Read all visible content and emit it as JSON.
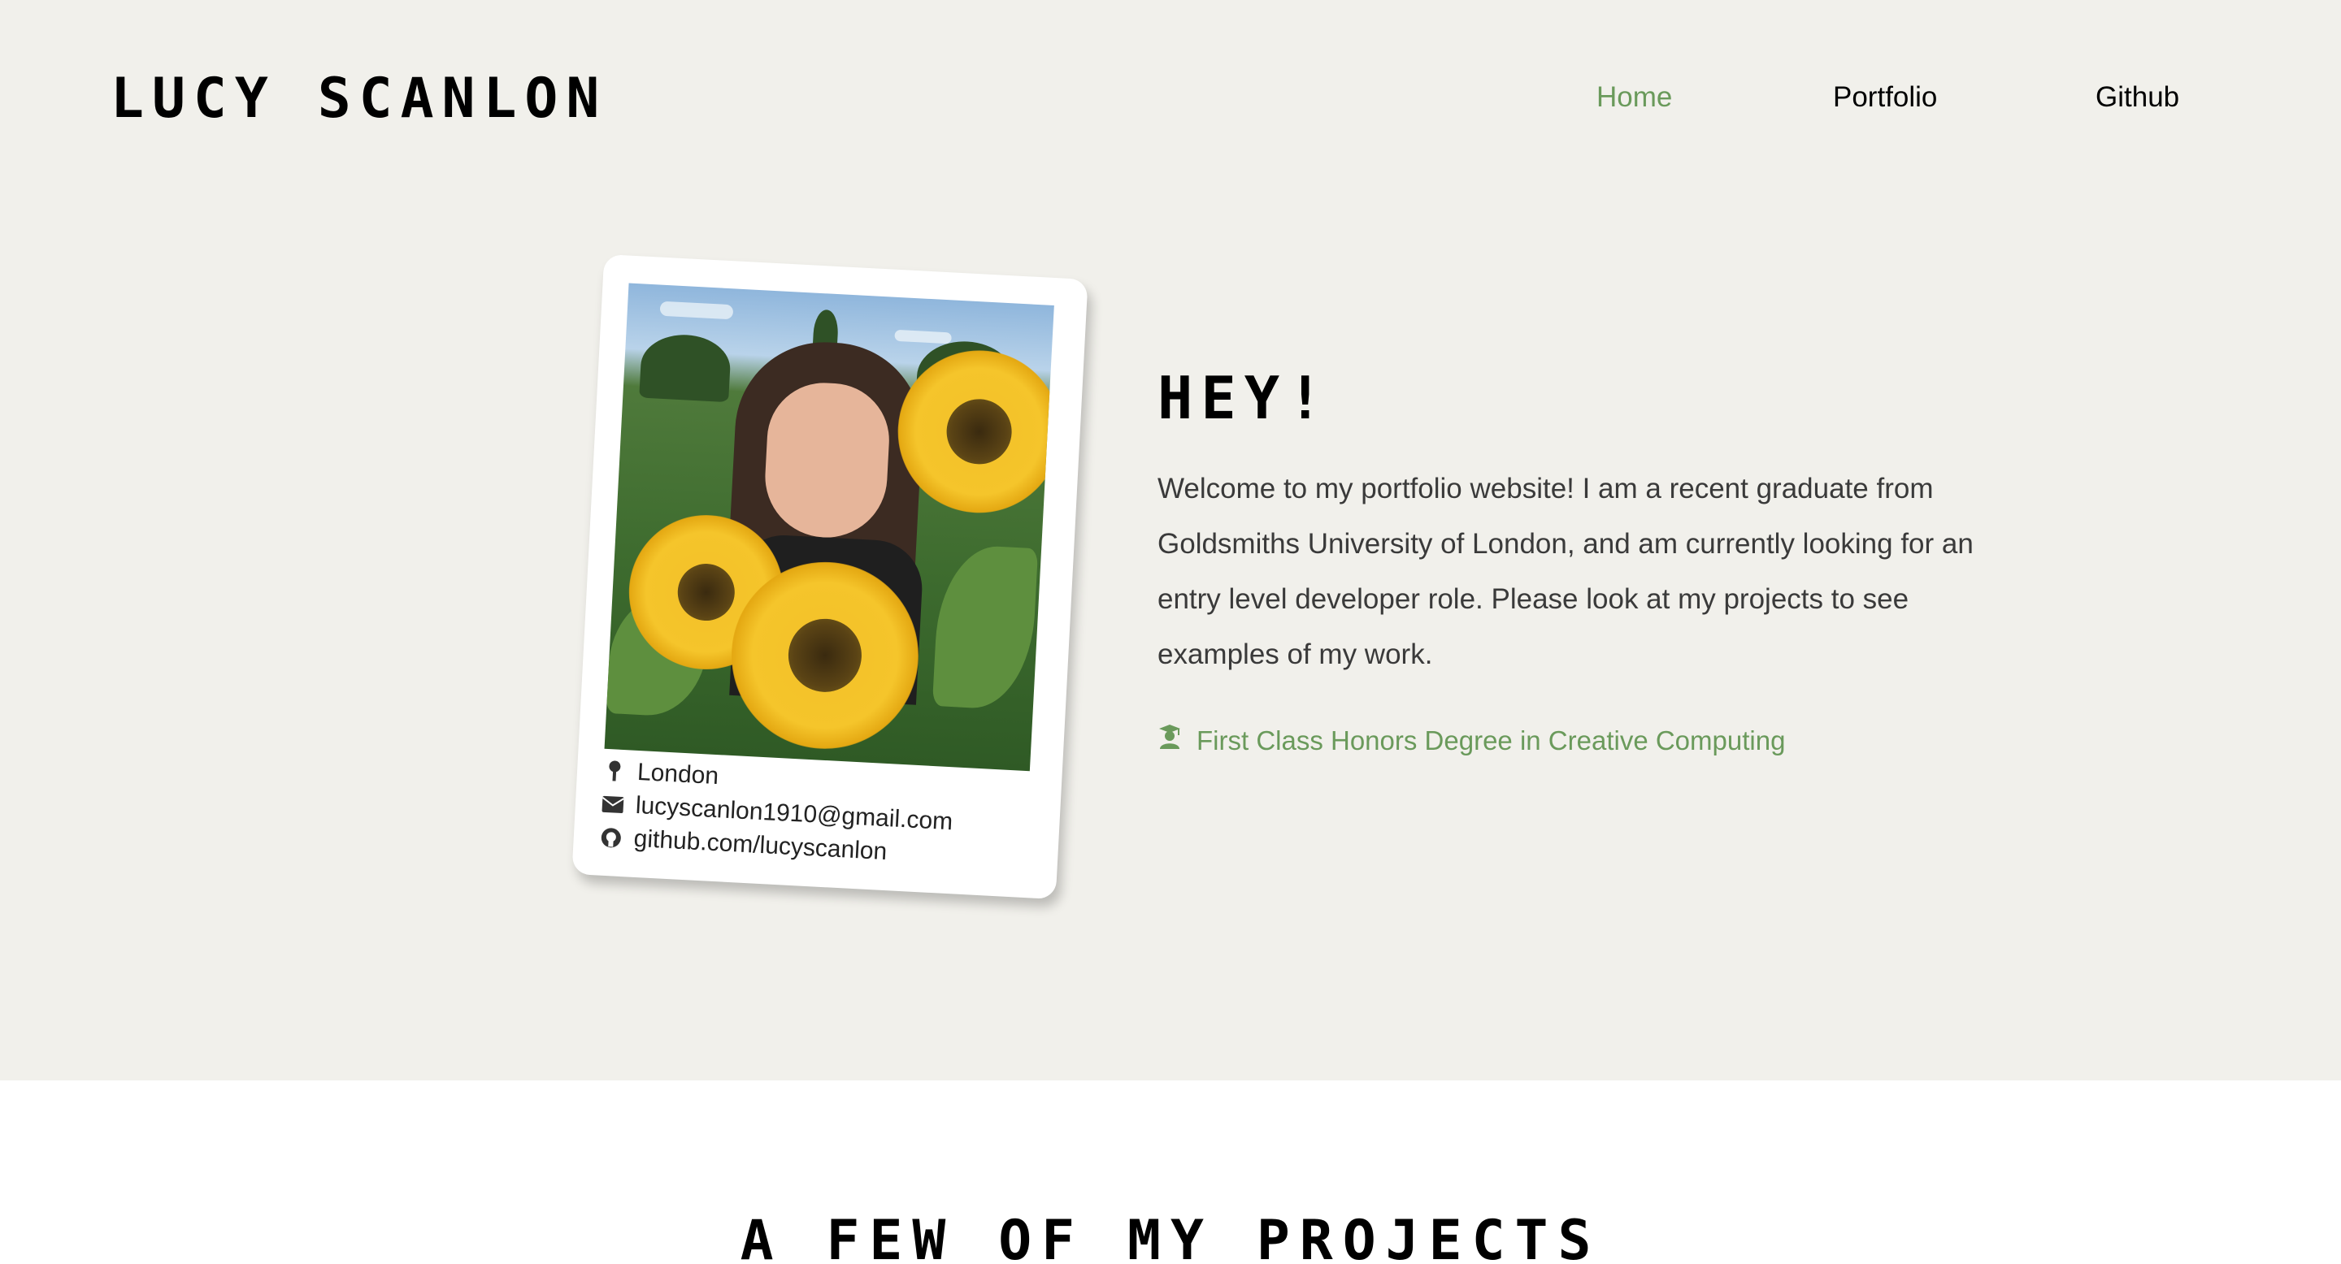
{
  "header": {
    "brand": "LUCY SCANLON",
    "nav": [
      {
        "label": "Home",
        "active": true
      },
      {
        "label": "Portfolio",
        "active": false
      },
      {
        "label": "Github",
        "active": false
      }
    ]
  },
  "profile_card": {
    "photo_alt": "portrait-in-sunflower-field",
    "location": "London",
    "email": "lucyscanlon1910@gmail.com",
    "github": "github.com/lucyscanlon",
    "icons": {
      "location": "map-pin-icon",
      "email": "envelope-icon",
      "github": "github-icon"
    }
  },
  "intro": {
    "heading": "HEY!",
    "body": "Welcome to my portfolio website! I am a recent graduate from Goldsmiths University of London, and am currently looking for an entry level developer role. Please look at my projects to see examples of my work.",
    "degree_icon": "graduate-icon",
    "degree": "First Class Honors Degree in Creative Computing"
  },
  "projects": {
    "heading": "A FEW OF MY PROJECTS"
  },
  "colors": {
    "hero_background": "#f1f0eb",
    "accent": "#6a9a5b",
    "text": "#3a3a3a",
    "page_background": "#ffffff"
  }
}
